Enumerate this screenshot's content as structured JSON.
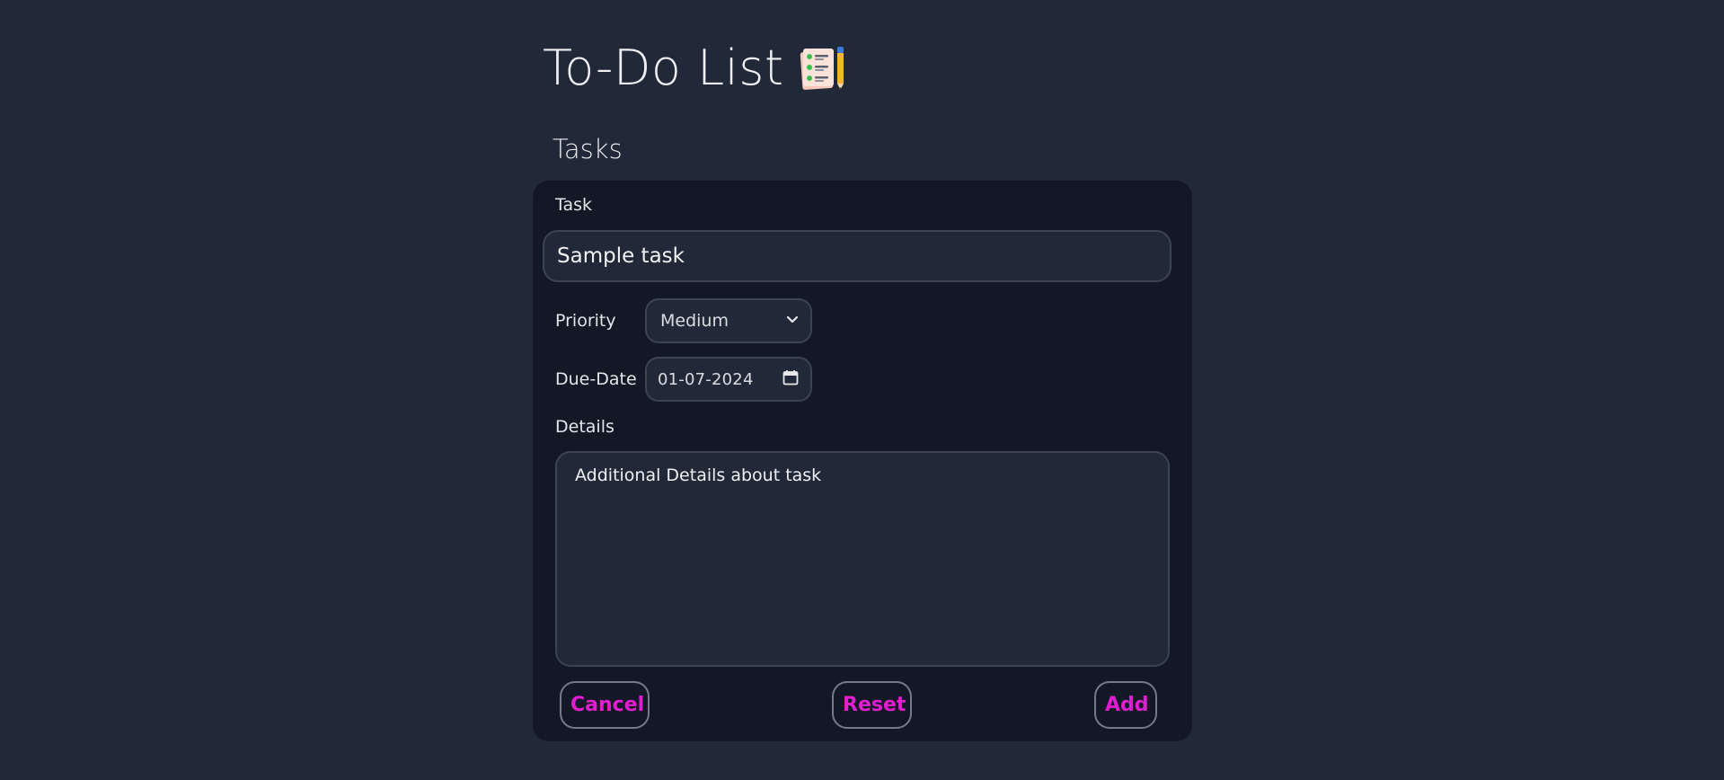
{
  "header": {
    "title": "To-Do List",
    "title_icon": "clipboard-with-pencil-icon"
  },
  "section": {
    "title": "Tasks"
  },
  "form": {
    "task_label": "Task",
    "task_value": "Sample task",
    "priority_label": "Priority",
    "priority_value": "Medium",
    "due_date_label": "Due-Date",
    "due_date_value": "01-07-2024",
    "details_label": "Details",
    "details_value": "Additional Details about task"
  },
  "actions": {
    "cancel_label": "Cancel",
    "reset_label": "Reset",
    "add_label": "Add"
  },
  "colors": {
    "background": "#212838",
    "card": "#121826",
    "accent": "#e11ecf",
    "border": "#3c4353"
  }
}
